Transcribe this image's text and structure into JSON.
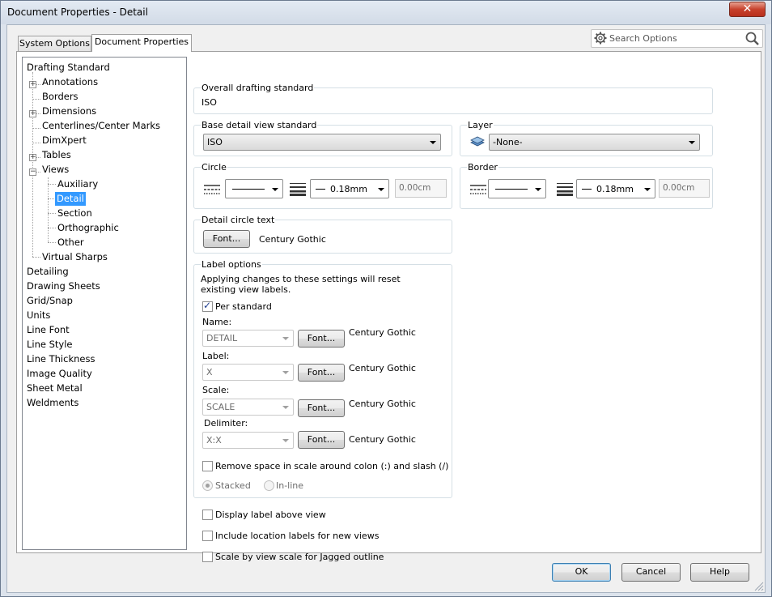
{
  "window": {
    "title": "Document Properties - Detail",
    "close": "✕"
  },
  "tabs": [
    {
      "label": "System Options",
      "active": false
    },
    {
      "label": "Document Properties",
      "active": true
    }
  ],
  "search": {
    "placeholder": "Search Options"
  },
  "tree": {
    "items": [
      {
        "label": "Drafting Standard"
      },
      {
        "label": "Annotations"
      },
      {
        "label": "Borders"
      },
      {
        "label": "Dimensions"
      },
      {
        "label": "Centerlines/Center Marks"
      },
      {
        "label": "DimXpert"
      },
      {
        "label": "Tables"
      },
      {
        "label": "Views"
      },
      {
        "label": "Auxiliary"
      },
      {
        "label": "Detail"
      },
      {
        "label": "Section"
      },
      {
        "label": "Orthographic"
      },
      {
        "label": "Other"
      },
      {
        "label": "Virtual Sharps"
      },
      {
        "label": "Detailing"
      },
      {
        "label": "Drawing Sheets"
      },
      {
        "label": "Grid/Snap"
      },
      {
        "label": "Units"
      },
      {
        "label": "Line Font"
      },
      {
        "label": "Line Style"
      },
      {
        "label": "Line Thickness"
      },
      {
        "label": "Image Quality"
      },
      {
        "label": "Sheet Metal"
      },
      {
        "label": "Weldments"
      }
    ]
  },
  "overall": {
    "title": "Overall drafting standard",
    "value": "ISO"
  },
  "base": {
    "title": "Base detail view standard",
    "value": "ISO"
  },
  "layer": {
    "title": "Layer",
    "value": "-None-"
  },
  "circle": {
    "title": "Circle",
    "thickness": "0.18mm",
    "custom": "0.00cm"
  },
  "border": {
    "title": "Border",
    "thickness": "0.18mm",
    "custom": "0.00cm"
  },
  "circle_text": {
    "title": "Detail circle text",
    "font_button": "Font...",
    "font_name": "Century Gothic"
  },
  "label_options": {
    "title": "Label options",
    "note": "Applying changes to these settings will reset existing view labels.",
    "per_standard": "Per standard",
    "name_label": "Name:",
    "name_value": "DETAIL",
    "label_label": "Label:",
    "label_value": "X",
    "scale_label": "Scale:",
    "scale_value": "SCALE",
    "delim_label": "Delimiter:",
    "delim_value": "X:X",
    "font_button": "Font...",
    "font_name": "Century Gothic",
    "remove_space": "Remove space in scale around colon (:) and slash (/)",
    "stacked": "Stacked",
    "inline": "In-line"
  },
  "options": {
    "display_above": "Display label above view",
    "include_location": "Include location labels for new views",
    "scale_jagged": "Scale by view scale for Jagged outline"
  },
  "buttons": {
    "ok": "OK",
    "cancel": "Cancel",
    "help": "Help"
  }
}
